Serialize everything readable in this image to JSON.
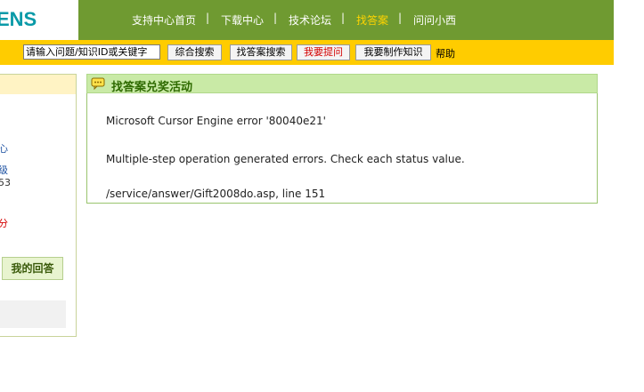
{
  "header": {
    "logo_text": "ENS",
    "nav": [
      {
        "label": "支持中心首页"
      },
      {
        "label": "下载中心"
      },
      {
        "label": "技术论坛"
      },
      {
        "label": "找答案"
      },
      {
        "label": "问问小西"
      }
    ],
    "separator": "|"
  },
  "searchbar": {
    "input_value": "请输入问题/知识ID或关键字",
    "buttons": {
      "general_search": "综合搜索",
      "answer_search": "找答案搜索",
      "ask_question": "我要提问",
      "make_knowledge": "我要制作知识"
    },
    "help": "帮助"
  },
  "left_panel": {
    "fragments": [
      "心",
      "级",
      "53",
      "分"
    ],
    "my_answers": "我的回答"
  },
  "main": {
    "title": "找答案兑奖活动",
    "error_lines": [
      "Microsoft Cursor Engine error '80040e21'",
      "Multiple-step operation generated errors. Check each status value.",
      "/service/answer/Gift2008do.asp, line 151"
    ]
  },
  "colors": {
    "nav_bg": "#6f9a31",
    "nav_active": "#ffd400",
    "searchbar_bg": "#ffcc00",
    "panel_head_bg": "#c9eaa6",
    "logo": "#0a9aa8"
  }
}
